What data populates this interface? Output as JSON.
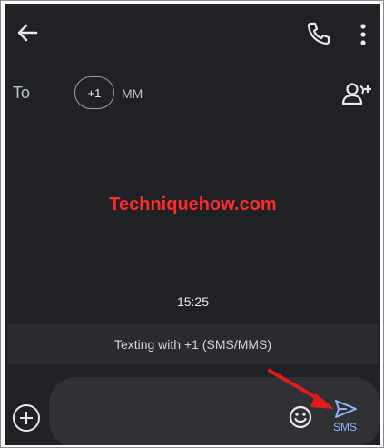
{
  "toolbar": {
    "back_icon": "arrow-back-icon",
    "call_icon": "phone-icon",
    "more_icon": "more-vert-icon"
  },
  "recipients": {
    "to_label": "To",
    "chip_text": "+1",
    "chip_name": "MM",
    "add_contact_icon": "person-add-icon"
  },
  "watermark": "Techniquehow.com",
  "conversation": {
    "timestamp": "15:25",
    "info_banner": "Texting with +1 (SMS/MMS)"
  },
  "composer": {
    "attach_icon": "add-circle-icon",
    "emoji_icon": "emoji-icon",
    "send_icon": "send-icon",
    "send_label": "SMS",
    "message_value": ""
  },
  "colors": {
    "background": "#202124",
    "accent": "#8ab4f8",
    "watermark": "#ff2a2a",
    "annotation_arrow": "#e31b1b"
  }
}
